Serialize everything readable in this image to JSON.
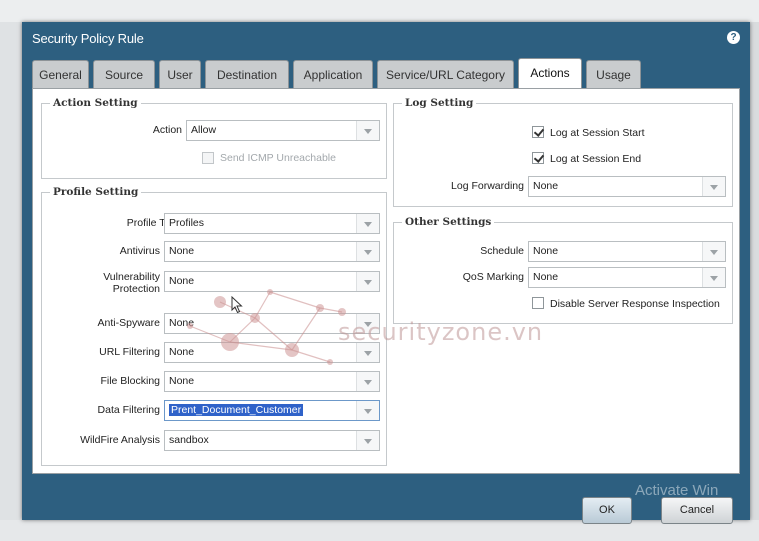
{
  "dialog": {
    "title": "Security Policy Rule"
  },
  "tabs": [
    {
      "label": "General"
    },
    {
      "label": "Source"
    },
    {
      "label": "User"
    },
    {
      "label": "Destination"
    },
    {
      "label": "Application"
    },
    {
      "label": "Service/URL Category"
    },
    {
      "label": "Actions",
      "active": true
    },
    {
      "label": "Usage"
    }
  ],
  "action_setting": {
    "legend": "Action Setting",
    "action_label": "Action",
    "action_value": "Allow",
    "send_icmp_label": "Send ICMP Unreachable"
  },
  "profile_setting": {
    "legend": "Profile Setting",
    "profile_type_label": "Profile Type",
    "profile_type_value": "Profiles",
    "antivirus_label": "Antivirus",
    "antivirus_value": "None",
    "vuln_label_1": "Vulnerability",
    "vuln_label_2": "Protection",
    "vuln_value": "None",
    "antispyware_label": "Anti-Spyware",
    "antispyware_value": "None",
    "url_label": "URL Filtering",
    "url_value": "None",
    "file_label": "File Blocking",
    "file_value": "None",
    "data_label": "Data Filtering",
    "data_value": "Prent_Document_Customer",
    "wildfire_label": "WildFire Analysis",
    "wildfire_value": "sandbox"
  },
  "log_setting": {
    "legend": "Log Setting",
    "log_start_label": "Log at Session Start",
    "log_end_label": "Log at Session End",
    "log_forwarding_label": "Log Forwarding",
    "log_forwarding_value": "None"
  },
  "other_settings": {
    "legend": "Other Settings",
    "schedule_label": "Schedule",
    "schedule_value": "None",
    "qos_label": "QoS Marking",
    "qos_value": "None",
    "disable_sri_label": "Disable Server Response Inspection"
  },
  "watermark": {
    "text": "securityzone.vn"
  },
  "os_notice": {
    "text": "Activate Win"
  },
  "buttons": {
    "ok": "OK",
    "cancel": "Cancel"
  },
  "colors": {
    "title_bar": "#2d5f80",
    "selection": "#2f62c9"
  }
}
